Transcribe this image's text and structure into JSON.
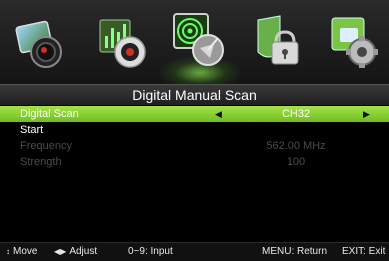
{
  "tabs": [
    {
      "icon": "picture-icon"
    },
    {
      "icon": "sound-icon"
    },
    {
      "icon": "channel-icon",
      "selected": true
    },
    {
      "icon": "lock-icon"
    },
    {
      "icon": "setup-icon"
    }
  ],
  "title": "Digital Manual Scan",
  "menu": [
    {
      "label": "Digital Scan",
      "value": "CH32",
      "selected": true,
      "enabled": true
    },
    {
      "label": "Start",
      "value": "",
      "enabled": true
    },
    {
      "label": "Frequency",
      "value": "562.00 MHz",
      "enabled": false
    },
    {
      "label": "Strength",
      "value": "100",
      "enabled": false
    }
  ],
  "help": {
    "move": "Move",
    "adjust": "Adjust",
    "input": "0~9: Input",
    "return": "MENU: Return",
    "exit": "EXIT: Exit"
  },
  "colors": {
    "selected_row": "#8cd237",
    "disabled_text": "#4b4b4b",
    "background": "#000000"
  }
}
